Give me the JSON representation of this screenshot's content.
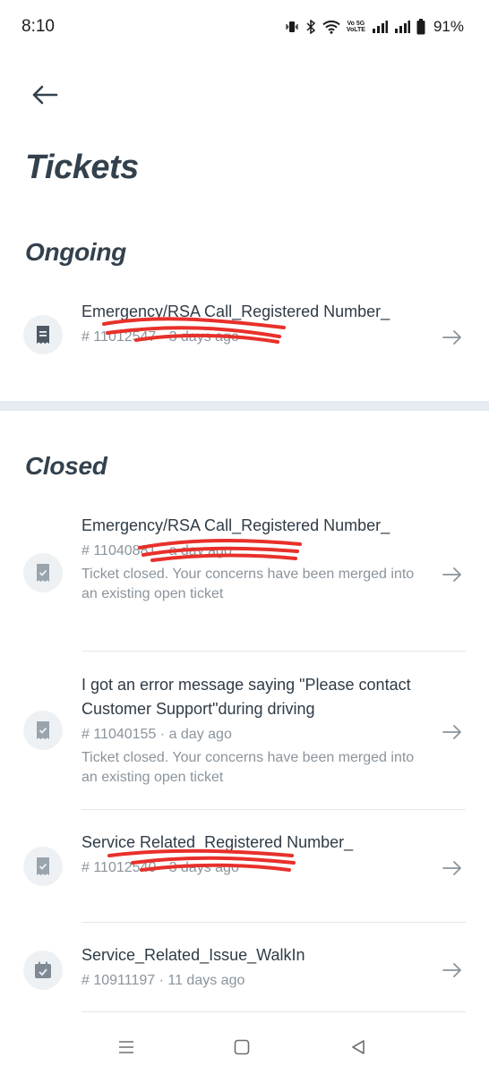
{
  "status_bar": {
    "time": "8:10",
    "network_label_top": "Vo 5G",
    "network_label_bottom": "VoLTE",
    "battery": "91%",
    "icons": [
      "vibrate-icon",
      "bluetooth-icon",
      "wifi-icon",
      "signal-icon",
      "signal-icon",
      "battery-icon"
    ]
  },
  "header": {
    "back_icon": "arrow-left-icon",
    "title": "Tickets"
  },
  "sections": {
    "ongoing": {
      "title": "Ongoing",
      "tickets": [
        {
          "title": "Emergency/RSA Call_Registered Number_",
          "meta": "# 11012547 · 3 days ago",
          "icon": "receipt-icon"
        }
      ]
    },
    "closed": {
      "title": "Closed",
      "tickets": [
        {
          "title": "Emergency/RSA Call_Registered Number_",
          "meta": "# 11040881 · a day ago",
          "note": "Ticket closed. Your concerns have been merged into an existing open ticket",
          "icon": "receipt-check-icon"
        },
        {
          "title": "I got an error message saying \"Please contact Customer Support\"during driving",
          "meta": "# 11040155 · a day ago",
          "note": "Ticket closed. Your concerns have been merged into an existing open ticket",
          "icon": "receipt-check-icon"
        },
        {
          "title": "Service Related_Registered Number_",
          "meta": "# 11012540 · 3 days ago",
          "icon": "receipt-check-icon"
        },
        {
          "title": "Service_Related_Issue_WalkIn",
          "meta": "# 10911197 · 11 days ago",
          "icon": "calendar-check-icon"
        }
      ]
    }
  },
  "nav_bar": {
    "icons": [
      "recents-icon",
      "home-icon",
      "back-triangle-icon"
    ]
  },
  "colors": {
    "title": "#33414d",
    "text": "#2f3b46",
    "muted": "#8a949d",
    "band": "#e5ebf0",
    "redaction": "#e8302a"
  }
}
